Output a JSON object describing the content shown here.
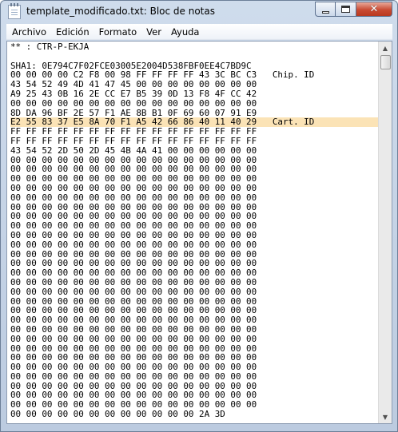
{
  "window": {
    "title": "template_modificado.txt: Bloc de notas",
    "controls": {
      "minimize": "",
      "maximize": "",
      "close": "✕"
    }
  },
  "menu": [
    "Archivo",
    "Edición",
    "Formato",
    "Ver",
    "Ayuda"
  ],
  "content": {
    "lines": [
      "** : CTR-P-EKJA",
      "",
      "SHA1: 0E794C7F02FCE03005E2004D538FBF0EE4C7BD9C",
      "00 00 00 00 C2 F8 00 98 FF FF FF FF 43 3C BC C3   Chip. ID",
      "43 54 52 49 4D 41 47 45 00 00 00 00 00 00 00 00",
      "A9 25 43 0B 16 2E CC E7 B5 39 0D 13 F8 4F CC 42",
      "00 00 00 00 00 00 00 00 00 00 00 00 00 00 00 00",
      "8D DA 96 BF 2E 57 F1 AE 8B B1 0F 69 60 07 91 E9",
      "E2 55 83 37 E5 8A 70 F1 A5 42 66 86 40 11 40 29   Cart. ID",
      "FF FF FF FF FF FF FF FF FF FF FF FF FF FF FF FF",
      "FF FF FF FF FF FF FF FF FF FF FF FF FF FF FF FF",
      "43 54 52 2D 50 2D 45 4B 4A 41 00 00 00 00 00 00",
      "00 00 00 00 00 00 00 00 00 00 00 00 00 00 00 00",
      "00 00 00 00 00 00 00 00 00 00 00 00 00 00 00 00",
      "00 00 00 00 00 00 00 00 00 00 00 00 00 00 00 00",
      "00 00 00 00 00 00 00 00 00 00 00 00 00 00 00 00",
      "00 00 00 00 00 00 00 00 00 00 00 00 00 00 00 00",
      "00 00 00 00 00 00 00 00 00 00 00 00 00 00 00 00",
      "00 00 00 00 00 00 00 00 00 00 00 00 00 00 00 00",
      "00 00 00 00 00 00 00 00 00 00 00 00 00 00 00 00",
      "00 00 00 00 00 00 00 00 00 00 00 00 00 00 00 00",
      "00 00 00 00 00 00 00 00 00 00 00 00 00 00 00 00",
      "00 00 00 00 00 00 00 00 00 00 00 00 00 00 00 00",
      "00 00 00 00 00 00 00 00 00 00 00 00 00 00 00 00",
      "00 00 00 00 00 00 00 00 00 00 00 00 00 00 00 00",
      "00 00 00 00 00 00 00 00 00 00 00 00 00 00 00 00",
      "00 00 00 00 00 00 00 00 00 00 00 00 00 00 00 00",
      "00 00 00 00 00 00 00 00 00 00 00 00 00 00 00 00",
      "00 00 00 00 00 00 00 00 00 00 00 00 00 00 00 00",
      "00 00 00 00 00 00 00 00 00 00 00 00 00 00 00 00",
      "00 00 00 00 00 00 00 00 00 00 00 00 00 00 00 00",
      "00 00 00 00 00 00 00 00 00 00 00 00 00 00 00 00",
      "00 00 00 00 00 00 00 00 00 00 00 00 00 00 00 00",
      "00 00 00 00 00 00 00 00 00 00 00 00 00 00 00 00",
      "00 00 00 00 00 00 00 00 00 00 00 00 00 00 00 00",
      "00 00 00 00 00 00 00 00 00 00 00 00 00 00 00 00",
      "00 00 00 00 00 00 00 00 00 00 00 00 00 00 00 00",
      "00 00 00 00 00 00 00 00 00 00 00 00 00 00 00 00",
      "00 00 00 00 00 00 00 00 00 00 00 00 00 00 00 00",
      "00 00 00 00 00 00 00 00 00 00 00 00 2A 3D"
    ],
    "highlighted_line": 8,
    "highlight_color": "#fbe3b6"
  },
  "scrollbar": {
    "up_arrow": "▲",
    "down_arrow": "▼"
  }
}
